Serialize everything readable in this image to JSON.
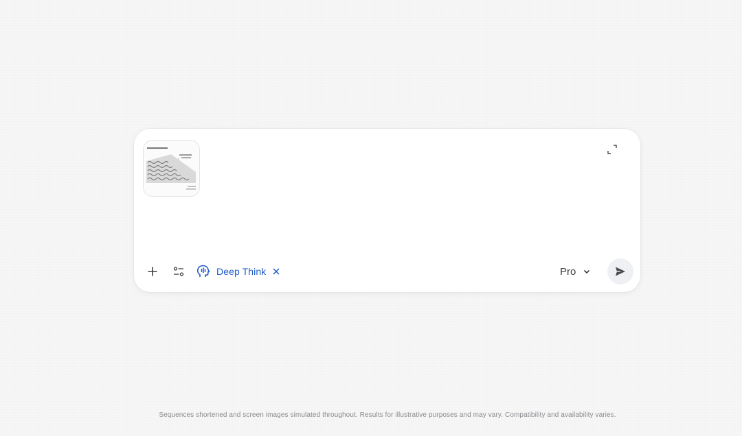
{
  "composer": {
    "attachment_icon": "image-thumbnail",
    "expand_icon": "expand-icon",
    "toolbar": {
      "add_icon": "plus-icon",
      "tools_icon": "tools-sliders-icon",
      "deep_think": {
        "icon": "deep-think-icon",
        "label": "Deep Think",
        "close_icon": "close-icon",
        "color": "#1f5cc8"
      },
      "model": {
        "label": "Pro",
        "icon": "chevron-down-icon"
      },
      "send_icon": "send-icon"
    }
  },
  "footer": {
    "disclaimer": "Sequences shortened and screen images simulated throughout. Results for illustrative purposes and may vary. Compatibility and availability varies."
  }
}
